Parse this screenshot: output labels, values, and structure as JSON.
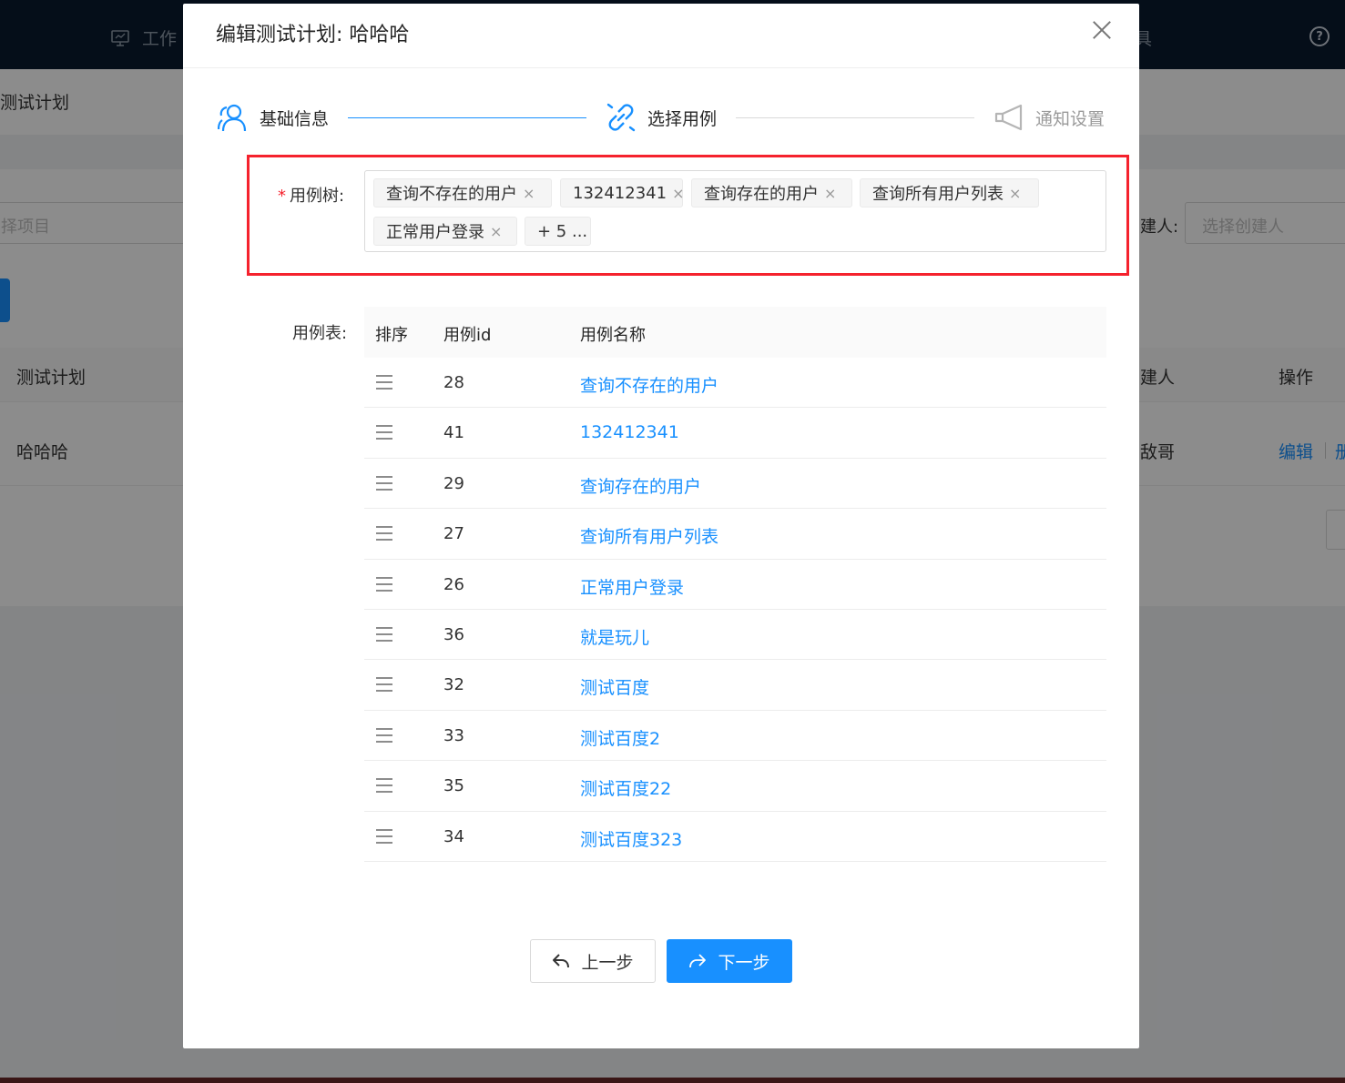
{
  "background": {
    "nav_work": "工作",
    "nav_right_fragment": "具",
    "breadcrumb": "测试计划",
    "project_placeholder": "择项目",
    "creator_label": "建人:",
    "creator_placeholder": "选择创建人",
    "table_headers": [
      "测试计划",
      "建人",
      "操作"
    ],
    "row": {
      "plan": "哈哈哈",
      "creator": "敌哥",
      "edit": "编辑",
      "delete": "册"
    }
  },
  "modal": {
    "title": "编辑测试计划: 哈哈哈",
    "steps": [
      {
        "label": "基础信息",
        "icon": "users-icon",
        "status": "done"
      },
      {
        "label": "选择用例",
        "icon": "link-icon",
        "status": "active"
      },
      {
        "label": "通知设置",
        "icon": "megaphone-icon",
        "status": "pending"
      }
    ],
    "case_tree": {
      "required_mark": "*",
      "label": "用例树:",
      "tags": [
        "查询不存在的用户",
        "132412341",
        "查询存在的用户",
        "查询所有用户列表",
        "正常用户登录"
      ],
      "tag_close": "×",
      "more": "+ 5 ..."
    },
    "case_table": {
      "label": "用例表:",
      "columns": [
        "排序",
        "用例id",
        "用例名称"
      ],
      "rows": [
        {
          "id": "28",
          "name": "查询不存在的用户"
        },
        {
          "id": "41",
          "name": "132412341"
        },
        {
          "id": "29",
          "name": "查询存在的用户"
        },
        {
          "id": "27",
          "name": "查询所有用户列表"
        },
        {
          "id": "26",
          "name": "正常用户登录"
        },
        {
          "id": "36",
          "name": "就是玩儿"
        },
        {
          "id": "32",
          "name": "测试百度"
        },
        {
          "id": "33",
          "name": "测试百度2"
        },
        {
          "id": "35",
          "name": "测试百度22"
        },
        {
          "id": "34",
          "name": "测试百度323"
        }
      ]
    },
    "buttons": {
      "prev": "上一步",
      "next": "下一步"
    }
  },
  "colors": {
    "primary": "#1890ff",
    "danger": "#f5222d",
    "header_bg": "#0a1a2e"
  }
}
